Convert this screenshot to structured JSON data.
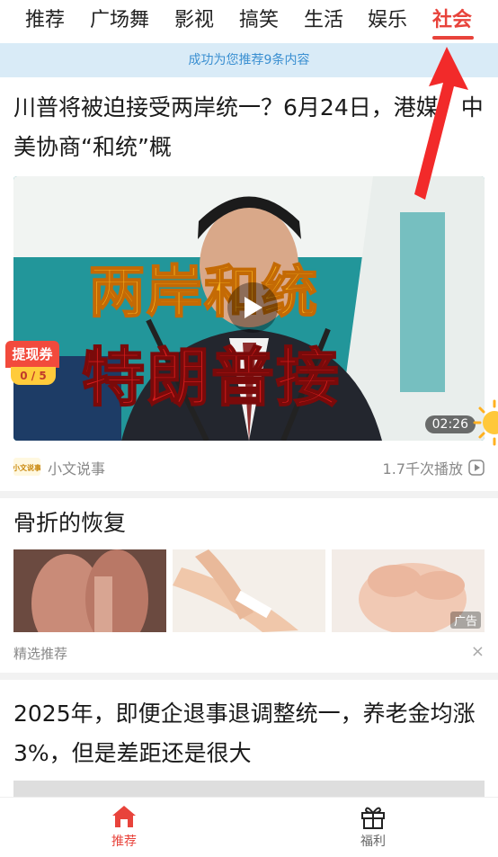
{
  "tabs": [
    {
      "label": "推荐",
      "active": false
    },
    {
      "label": "广场舞",
      "active": false
    },
    {
      "label": "影视",
      "active": false
    },
    {
      "label": "搞笑",
      "active": false
    },
    {
      "label": "生活",
      "active": false
    },
    {
      "label": "娱乐",
      "active": false
    },
    {
      "label": "社会",
      "active": true
    }
  ],
  "banner": {
    "text": "成功为您推荐9条内容"
  },
  "article1": {
    "title": "川普将被迫接受两岸统一？6月24日，港媒：中美协商“和统”概",
    "video": {
      "overlay_line1": "两岸和统",
      "overlay_line2": "特朗普接",
      "duration": "02:26"
    },
    "coupon": {
      "label": "提现券",
      "progress": "0 / 5"
    },
    "source_logo_text": "小文说事",
    "source": "小文说事",
    "plays": "1.7千次播放"
  },
  "article2": {
    "title": "骨折的恢复",
    "ad_tag": "广告",
    "footer": "精选推荐",
    "close": "×"
  },
  "article3": {
    "title": "2025年，即便企退事退调整统一，养老金均涨3%，但是差距还是很大"
  },
  "bottom_nav": [
    {
      "label": "推荐",
      "icon": "home-icon",
      "active": true
    },
    {
      "label": "福利",
      "icon": "gift-icon",
      "active": false
    }
  ],
  "colors": {
    "accent": "#e8433b",
    "banner_bg": "#d9ebf7",
    "banner_text": "#3a8fd1"
  }
}
